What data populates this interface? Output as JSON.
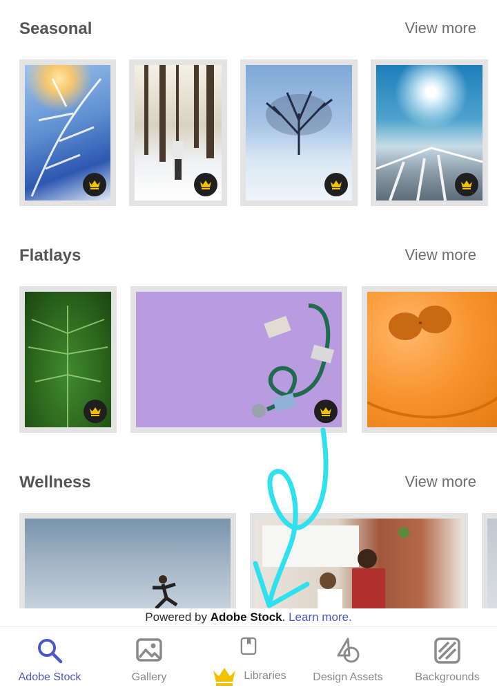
{
  "sections": [
    {
      "title": "Seasonal",
      "view_more": "View more"
    },
    {
      "title": "Flatlays",
      "view_more": "View more"
    },
    {
      "title": "Wellness",
      "view_more": "View more"
    }
  ],
  "credit": {
    "prefix": "Powered by ",
    "brand": "Adobe Stock",
    "suffix": ". ",
    "link": "Learn more."
  },
  "tabs": [
    {
      "label": "Adobe Stock",
      "icon": "search-icon",
      "active": true
    },
    {
      "label": "Gallery",
      "icon": "gallery-icon"
    },
    {
      "label": "Libraries",
      "icon": "libraries-icon",
      "premium": true
    },
    {
      "label": "Design Assets",
      "icon": "design-assets-icon"
    },
    {
      "label": "Backgrounds",
      "icon": "backgrounds-icon"
    }
  ],
  "colors": {
    "accent": "#4b57c8",
    "premium_crown": "#f2c200",
    "annotation": "#2fe0ee"
  }
}
